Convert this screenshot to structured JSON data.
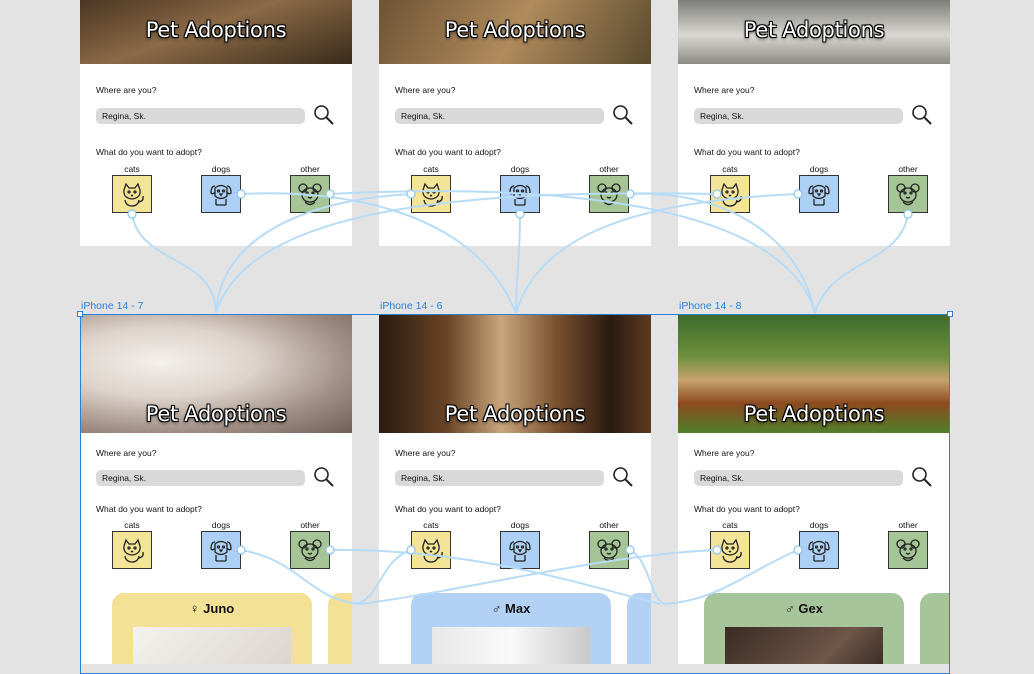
{
  "app": {
    "title": "Pet Adoptions"
  },
  "form": {
    "location_prompt": "Where are you?",
    "location_value": "Regina, Sk.",
    "adopt_prompt": "What do you want to adopt?"
  },
  "categories": {
    "cats": "cats",
    "dogs": "dogs",
    "other": "other"
  },
  "frames": [
    {
      "name": "iPhone 14 - 7"
    },
    {
      "name": "iPhone 14 - 6"
    },
    {
      "name": "iPhone 14 - 8"
    }
  ],
  "pets": [
    {
      "name": "♀ Juno",
      "color": "#f3e195"
    },
    {
      "name": "♂ Max",
      "color": "#b3d1f5"
    },
    {
      "name": "♂ Gex",
      "color": "#a7c59a"
    }
  ],
  "colors": {
    "cats": "#f4e497",
    "dogs": "#acd0f6",
    "other": "#a5c596",
    "selection": "#2b7fd6",
    "wire": "#b7dcf7"
  },
  "icons": [
    "cat-icon",
    "dog-icon",
    "mouse-icon",
    "search-icon"
  ]
}
